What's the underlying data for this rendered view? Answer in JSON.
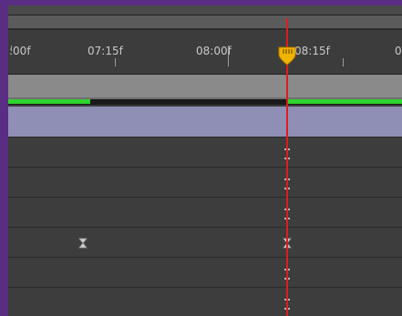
{
  "timeline": {
    "ruler_labels": [
      ":00f",
      "07:15f",
      "08:00f",
      "08:15f",
      "0"
    ],
    "render_bar_color": "#2fd42f",
    "playhead_color": "#e01c1c",
    "playhead_head_color": "#f0b400",
    "comp_row_color": "#8f8fb5",
    "layer_rows": [
      {
        "keyframes": [
          "ibeam-keyframe-icon"
        ]
      },
      {
        "keyframes": [
          "ibeam-keyframe-icon"
        ]
      },
      {
        "keyframes": [
          "ibeam-keyframe-icon"
        ]
      },
      {
        "keyframes": [
          "hourglass-keyframe-icon",
          "hourglass-keyframe-icon"
        ]
      },
      {
        "keyframes": [
          "ibeam-keyframe-icon"
        ]
      },
      {
        "keyframes": [
          "ibeam-keyframe-icon"
        ]
      }
    ]
  }
}
